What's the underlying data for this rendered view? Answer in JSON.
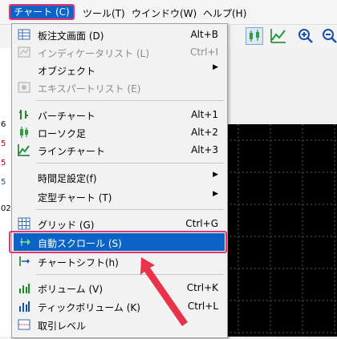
{
  "menubar": {
    "chart": "チャート (C)",
    "tools": "ツール(T)",
    "window": "ウインドウ(W)",
    "help": "ヘルプ(H)"
  },
  "left_strip": [
    "6",
    "5",
    "5",
    "5",
    "02"
  ],
  "menu_items": [
    {
      "label": "板注文画面 (D)",
      "shortcut": "Alt+B",
      "icon": "order-book-icon"
    },
    {
      "label": "インディケータリスト (L)",
      "shortcut": "Ctrl+I",
      "icon": "indicator-list-icon",
      "disabled": true
    },
    {
      "label": "オブジェクト",
      "submenu": true
    },
    {
      "label": "エキスパートリスト (E)",
      "icon": "expert-list-icon",
      "disabled": true
    },
    {
      "label": "バーチャート",
      "shortcut": "Alt+1",
      "icon": "bar-chart-icon"
    },
    {
      "label": "ローソク足",
      "shortcut": "Alt+2",
      "icon": "candlestick-icon"
    },
    {
      "label": "ラインチャート",
      "shortcut": "Alt+3",
      "icon": "line-chart-icon"
    },
    {
      "label": "時間足設定(f)",
      "submenu": true
    },
    {
      "label": "定型チャート (T)",
      "submenu": true
    },
    {
      "label": "グリッド (G)",
      "shortcut": "Ctrl+G",
      "icon": "grid-icon"
    },
    {
      "label": "自動スクロール (S)",
      "icon": "auto-scroll-icon",
      "selected": true
    },
    {
      "label": "チャートシフト(h)",
      "icon": "chart-shift-icon"
    },
    {
      "label": "ボリューム (V)",
      "shortcut": "Ctrl+K",
      "icon": "volume-icon"
    },
    {
      "label": "ティックボリューム (K)",
      "shortcut": "Ctrl+L",
      "icon": "tick-volume-icon"
    },
    {
      "label": "取引レベル",
      "icon": "trade-levels-icon"
    }
  ],
  "colors": {
    "selection": "#0a64c8",
    "annotation": "#e8336d",
    "arrow": "#e8334a"
  }
}
